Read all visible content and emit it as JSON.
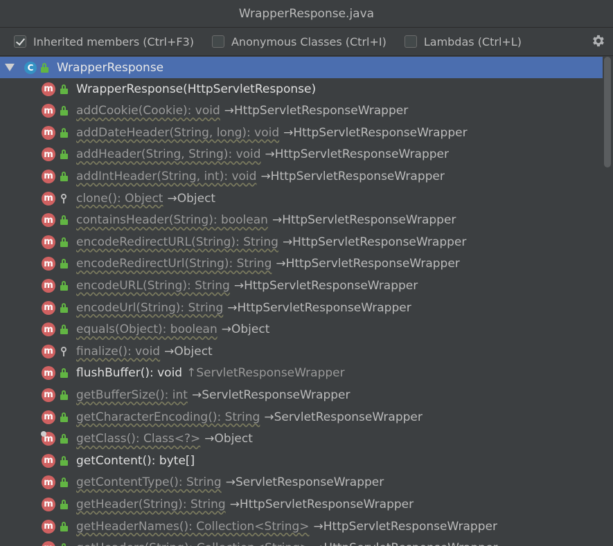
{
  "window": {
    "title": "WrapperResponse.java"
  },
  "toolbar": {
    "options": [
      {
        "label": "Inherited members (Ctrl+F3)",
        "checked": true
      },
      {
        "label": "Anonymous Classes (Ctrl+I)",
        "checked": false
      },
      {
        "label": "Lambdas (Ctrl+L)",
        "checked": false
      }
    ],
    "settings_icon": "gear-icon"
  },
  "tree": {
    "root": {
      "label": "WrapperResponse",
      "icon": "class-icon"
    },
    "members": [
      {
        "name": "WrapperResponse(HttpServletResponse)",
        "owner": "",
        "own": true,
        "access": "public"
      },
      {
        "name": "addCookie(Cookie): void",
        "owner": "→HttpServletResponseWrapper",
        "own": false,
        "access": "public"
      },
      {
        "name": "addDateHeader(String, long): void",
        "owner": "→HttpServletResponseWrapper",
        "own": false,
        "access": "public"
      },
      {
        "name": "addHeader(String, String): void",
        "owner": "→HttpServletResponseWrapper",
        "own": false,
        "access": "public"
      },
      {
        "name": "addIntHeader(String, int): void",
        "owner": "→HttpServletResponseWrapper",
        "own": false,
        "access": "public"
      },
      {
        "name": "clone(): Object",
        "owner": "→Object",
        "own": false,
        "access": "protected"
      },
      {
        "name": "containsHeader(String): boolean",
        "owner": "→HttpServletResponseWrapper",
        "own": false,
        "access": "public"
      },
      {
        "name": "encodeRedirectURL(String): String",
        "owner": "→HttpServletResponseWrapper",
        "own": false,
        "access": "public"
      },
      {
        "name": "encodeRedirectUrl(String): String",
        "owner": "→HttpServletResponseWrapper",
        "own": false,
        "access": "public"
      },
      {
        "name": "encodeURL(String): String",
        "owner": "→HttpServletResponseWrapper",
        "own": false,
        "access": "public"
      },
      {
        "name": "encodeUrl(String): String",
        "owner": "→HttpServletResponseWrapper",
        "own": false,
        "access": "public"
      },
      {
        "name": "equals(Object): boolean",
        "owner": "→Object",
        "own": false,
        "access": "public"
      },
      {
        "name": "finalize(): void",
        "owner": "→Object",
        "own": false,
        "access": "protected"
      },
      {
        "name": "flushBuffer(): void",
        "owner": "↑ServletResponseWrapper",
        "own": true,
        "access": "public"
      },
      {
        "name": "getBufferSize(): int",
        "owner": "→ServletResponseWrapper",
        "own": false,
        "access": "public"
      },
      {
        "name": "getCharacterEncoding(): String",
        "owner": "→ServletResponseWrapper",
        "own": false,
        "access": "public"
      },
      {
        "name": "getClass(): Class<?>",
        "owner": "→Object",
        "own": false,
        "access": "public",
        "marked": true
      },
      {
        "name": "getContent(): byte[]",
        "owner": "",
        "own": true,
        "access": "public"
      },
      {
        "name": "getContentType(): String",
        "owner": "→ServletResponseWrapper",
        "own": false,
        "access": "public"
      },
      {
        "name": "getHeader(String): String",
        "owner": "→HttpServletResponseWrapper",
        "own": false,
        "access": "public"
      },
      {
        "name": "getHeaderNames(): Collection<String>",
        "owner": "→HttpServletResponseWrapper",
        "own": false,
        "access": "public"
      },
      {
        "name": "getHeaders(String): Collection<String>",
        "owner": "→HttpServletResponseWrapper",
        "own": false,
        "access": "public"
      }
    ]
  },
  "colors": {
    "background": "#3c3f41",
    "selection": "#4b6eaf",
    "method_badge": "#d06161",
    "class_badge": "#3592c4",
    "public_lock": "#62b543"
  }
}
